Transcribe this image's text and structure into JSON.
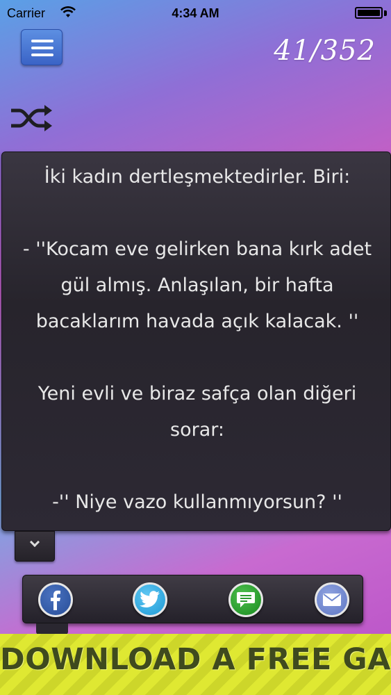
{
  "status_bar": {
    "carrier": "Carrier",
    "time": "4:34 AM"
  },
  "header": {
    "counter": "41/352"
  },
  "icons": {
    "menu": "hamburger-icon",
    "shuffle": "shuffle-icon",
    "expand": "chevron-down-icon",
    "facebook": "facebook-icon",
    "twitter": "twitter-icon",
    "sms": "chat-bubble-icon",
    "mail": "mail-icon"
  },
  "joke": {
    "text": "İki kadın dertleşmektedirler. Biri:\n\n- ''Kocam eve gelirken bana kırk adet gül almış. Anlaşılan, bir hafta bacaklarım havada açık kalacak. ''\n\nYeni evli ve biraz safça olan diğeri sorar:\n\n-'' Niye vazo kullanmıyorsun? ''"
  },
  "ad": {
    "text": "DOWNLOAD A FREE GAME!"
  },
  "colors": {
    "menu_button": "#4a78d4",
    "panel": "#2b2830",
    "ad_background": "#dfe832",
    "ad_text": "#3f4a1e"
  }
}
